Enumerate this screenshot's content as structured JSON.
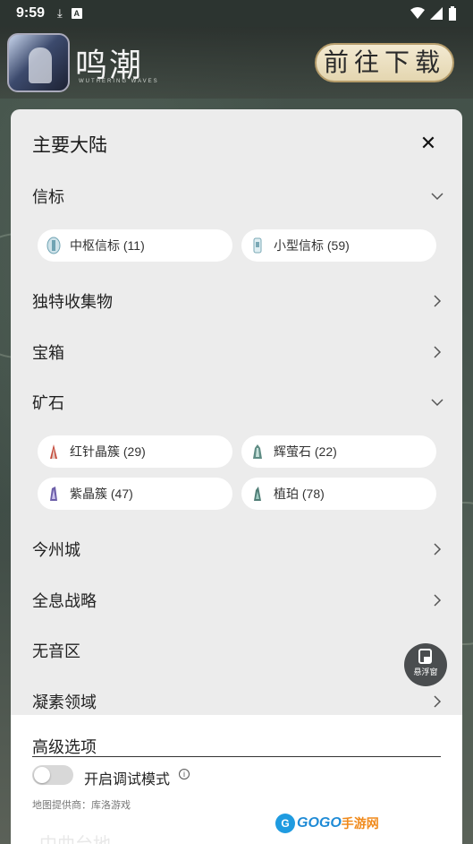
{
  "status_bar": {
    "time": "9:59"
  },
  "banner": {
    "game_title": "鸣潮",
    "game_subtitle": "WUTHERING WAVES",
    "download_label": "前往下载"
  },
  "panel": {
    "title": "主要大陆",
    "sections": [
      {
        "label": "信标",
        "expanded": true
      },
      {
        "label": "独特收集物",
        "expanded": false
      },
      {
        "label": "宝箱",
        "expanded": false
      },
      {
        "label": "矿石",
        "expanded": true
      },
      {
        "label": "今州城",
        "expanded": false
      },
      {
        "label": "全息战略",
        "expanded": false
      },
      {
        "label": "无音区",
        "expanded": false
      },
      {
        "label": "凝素领域",
        "expanded": false
      }
    ],
    "beacon_chips": [
      {
        "label": "中枢信标 (11)",
        "icon": "central-beacon-icon"
      },
      {
        "label": "小型信标 (59)",
        "icon": "small-beacon-icon"
      }
    ],
    "ore_chips": [
      {
        "label": "红针晶簇 (29)",
        "icon": "red-crystal-icon"
      },
      {
        "label": "辉萤石 (22)",
        "icon": "glow-stone-icon"
      },
      {
        "label": "紫晶簇 (47)",
        "icon": "purple-crystal-icon"
      },
      {
        "label": "植珀 (78)",
        "icon": "amber-plant-icon"
      }
    ]
  },
  "advanced": {
    "label": "高级选项",
    "debug_mode_label": "开启调试模式",
    "debug_mode_on": false,
    "provider": "地图提供商：库洛游戏"
  },
  "floating_button": {
    "label": "悬浮窗"
  },
  "watermark": {
    "text": "GOGO",
    "text2": "手游网"
  },
  "map_label": "中曲台地"
}
